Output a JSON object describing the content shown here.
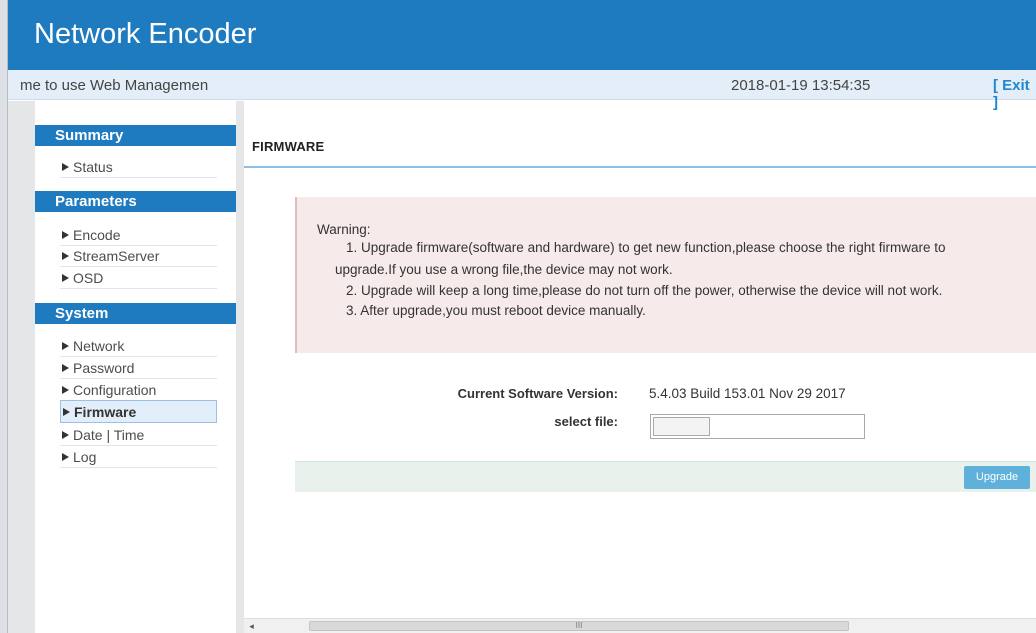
{
  "header": {
    "title": "Network Encoder"
  },
  "subbar": {
    "marquee": "me to use Web Managemen",
    "datetime": "2018-01-19 13:54:35",
    "exit_label": "[ Exit ]"
  },
  "sidebar": {
    "sections": [
      {
        "title": "Summary",
        "items": [
          "Status"
        ]
      },
      {
        "title": "Parameters",
        "items": [
          "Encode",
          "StreamServer",
          "OSD"
        ]
      },
      {
        "title": "System",
        "items": [
          "Network",
          "Password",
          "Configuration",
          "Firmware",
          "Date | Time",
          "Log"
        ]
      }
    ],
    "active_item": "Firmware"
  },
  "main": {
    "page_title": "FIRMWARE",
    "warning": {
      "heading": "Warning:",
      "lines": [
        "1. Upgrade firmware(software and hardware) to get new function,please choose the right firmware to",
        "upgrade.If you use a wrong file,the device may not work.",
        "2. Upgrade will keep a long time,please do not turn off the power, otherwise the device will not work.",
        "3. After upgrade,you must reboot device manually."
      ]
    },
    "current_version_label": "Current Software Version:",
    "current_version_value": "5.4.03 Build 153.01 Nov 29 2017",
    "select_file_label": "select file:",
    "upgrade_label": "Upgrade"
  },
  "scrollbar": {
    "arrow_left": "◂",
    "thumb_grip": "III"
  },
  "colors": {
    "brand": "#1f7bc0",
    "warning_bg": "#f7eaea",
    "action_bg": "#e8f1ec",
    "button": "#5fb1dc"
  }
}
